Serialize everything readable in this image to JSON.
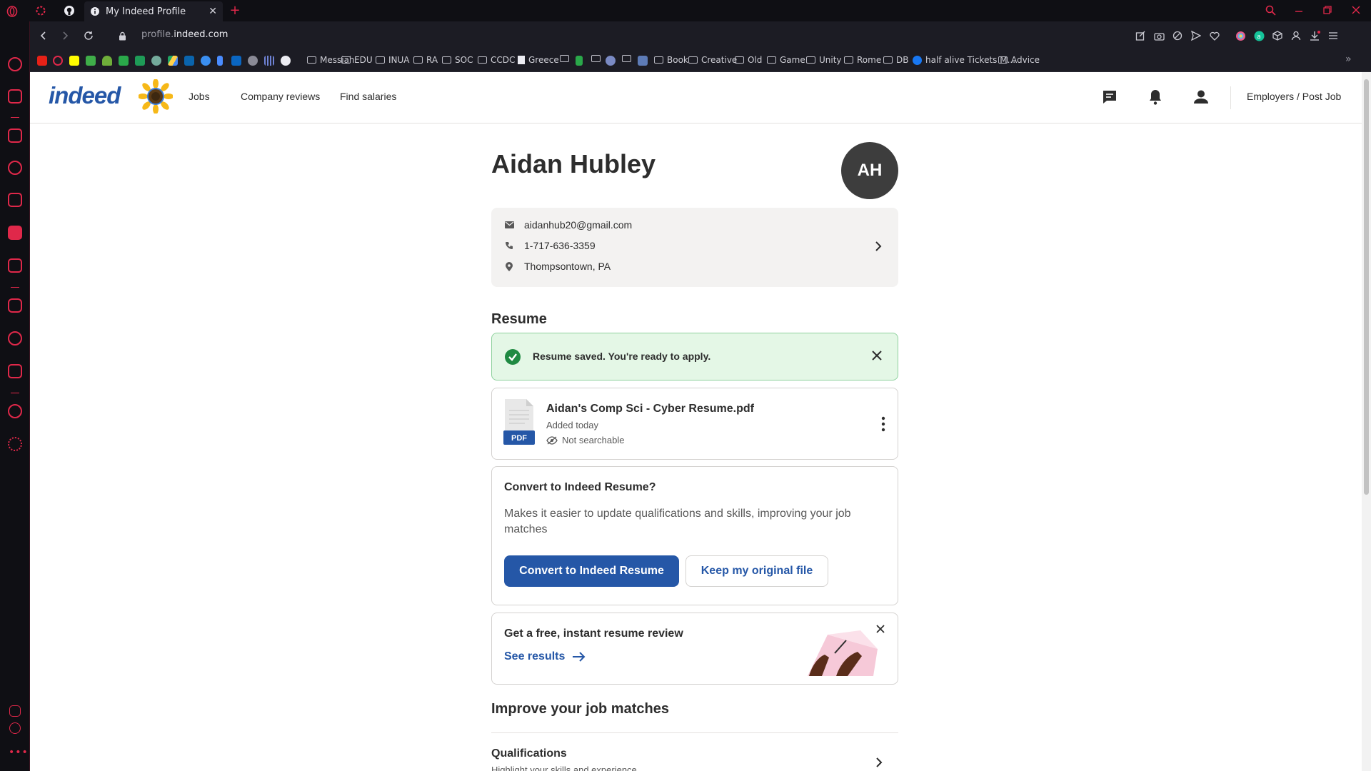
{
  "browser": {
    "tab_title": "My Indeed Profile",
    "url_prefix": "profile.",
    "url_domain": "indeed.com",
    "bookmarks": [
      "Messiah",
      "EDU",
      "INUA",
      "RA",
      "SOC",
      "CCDC",
      "Greece",
      "Book",
      "Creative",
      "Old",
      "Game",
      "Unity",
      "Rome",
      "DB",
      "half alive Tickets M...",
      "Advice"
    ],
    "more_bookmarks": "»"
  },
  "header": {
    "logo_text": "indeed",
    "nav": [
      "Jobs",
      "Company reviews",
      "Find salaries"
    ],
    "employers_link": "Employers / Post Job",
    "icons": [
      "messages-icon",
      "notifications-icon",
      "account-icon"
    ]
  },
  "profile": {
    "name": "Aidan Hubley",
    "initials": "AH",
    "email": "aidanhub20@gmail.com",
    "phone": "1-717-636-3359",
    "location": "Thompsontown, PA"
  },
  "resume": {
    "section_title": "Resume",
    "toast": "Resume saved. You're ready to apply.",
    "file_name": "Aidan's Comp Sci - Cyber Resume.pdf",
    "file_badge": "PDF",
    "added": "Added today",
    "visibility": "Not searchable"
  },
  "convert": {
    "title": "Convert to Indeed Resume?",
    "description": "Makes it easier to update qualifications and skills, improving your job matches",
    "primary_button": "Convert to Indeed Resume",
    "secondary_button": "Keep my original file"
  },
  "review": {
    "title": "Get a free, instant resume review",
    "link": "See results"
  },
  "improve": {
    "section_title": "Improve your job matches",
    "qualifications_title": "Qualifications",
    "qualifications_sub": "Highlight your skills and experience"
  },
  "colors": {
    "indeed_blue": "#2557a7",
    "success_green": "#1f8a42",
    "opera_red": "#e0284a"
  }
}
